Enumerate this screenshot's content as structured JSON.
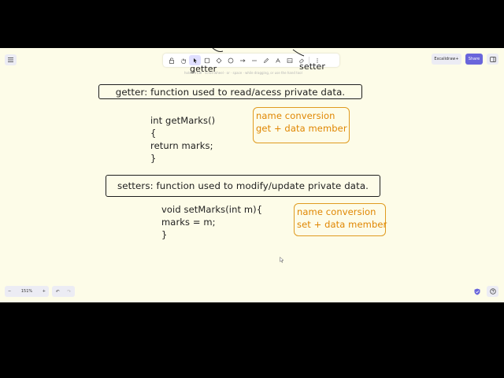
{
  "toolbar": {
    "tools": [
      {
        "name": "lock-tool",
        "icon": "lock-icon"
      },
      {
        "name": "hand-tool",
        "icon": "hand-icon"
      },
      {
        "name": "selection-tool",
        "icon": "cursor-icon",
        "active": true
      },
      {
        "name": "rectangle-tool",
        "icon": "square-icon"
      },
      {
        "name": "diamond-tool",
        "icon": "diamond-icon"
      },
      {
        "name": "ellipse-tool",
        "icon": "circle-icon"
      },
      {
        "name": "arrow-tool",
        "icon": "arrow-icon"
      },
      {
        "name": "line-tool",
        "icon": "line-icon"
      },
      {
        "name": "draw-tool",
        "icon": "pencil-icon"
      },
      {
        "name": "text-tool",
        "icon": "text-icon"
      },
      {
        "name": "image-tool",
        "icon": "image-icon"
      },
      {
        "name": "eraser-tool",
        "icon": "eraser-icon"
      },
      {
        "name": "more-tools",
        "icon": "more-icon"
      }
    ],
    "hint_text": "hold Ctrl/⌘ · scroll wheel · or · space · while dragging, or use the hand tool"
  },
  "header": {
    "library_label": "Excalidraw+",
    "share_label": "Share"
  },
  "canvas": {
    "partial_getter": "getter",
    "partial_setter": "setter",
    "getter_def": "getter: function used to read/acess private data.",
    "getter_code": [
      "int getMarks()",
      "{",
      "return marks;",
      "}"
    ],
    "getter_note": [
      "name conversion",
      "get + data member"
    ],
    "setter_def": "setters: function used to modify/update private data.",
    "setter_code": [
      "void setMarks(int m){",
      "marks = m;",
      "}"
    ],
    "setter_note": [
      "name conversion",
      "set + data member"
    ]
  },
  "footer": {
    "zoom_out": "−",
    "zoom_level": "151%",
    "zoom_in": "+",
    "undo": "↶",
    "redo": "↷"
  },
  "colors": {
    "canvas": "#fdfce8",
    "accent": "#6965db",
    "note": "#e08600",
    "stroke": "#1e1e1e"
  }
}
